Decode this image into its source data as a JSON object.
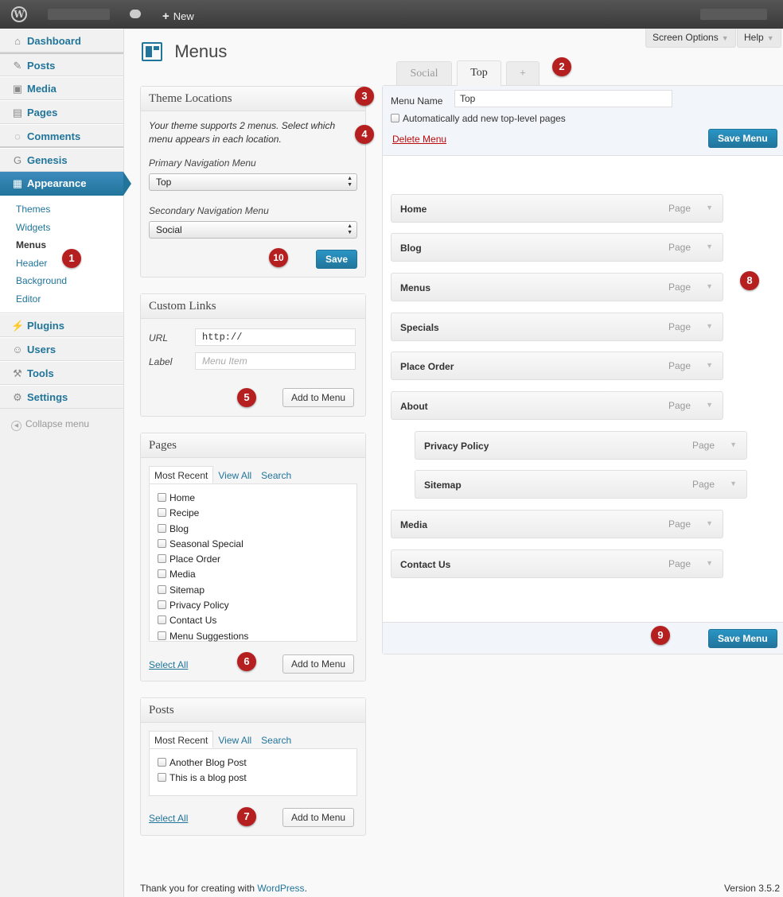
{
  "adminbar": {
    "logo": "W",
    "new_label": "New"
  },
  "sidebar": {
    "items": [
      {
        "label": "Dashboard",
        "icon": "home-icon"
      },
      {
        "label": "Posts",
        "icon": "pin-icon"
      },
      {
        "label": "Media",
        "icon": "media-icon"
      },
      {
        "label": "Pages",
        "icon": "pages-icon"
      },
      {
        "label": "Comments",
        "icon": "comments-icon"
      },
      {
        "label": "Genesis",
        "icon": "genesis-icon"
      },
      {
        "label": "Appearance",
        "icon": "appearance-icon"
      }
    ],
    "submenu": [
      "Themes",
      "Widgets",
      "Menus",
      "Header",
      "Background",
      "Editor"
    ],
    "items2": [
      {
        "label": "Plugins",
        "icon": "plugins-icon"
      },
      {
        "label": "Users",
        "icon": "users-icon"
      },
      {
        "label": "Tools",
        "icon": "tools-icon"
      },
      {
        "label": "Settings",
        "icon": "settings-icon"
      }
    ],
    "collapse": "Collapse menu"
  },
  "screen_options": "Screen Options",
  "help": "Help",
  "page_title": "Menus",
  "theme_locations": {
    "title": "Theme Locations",
    "intro": "Your theme supports 2 menus. Select which menu appears in each location.",
    "primary_label": "Primary Navigation Menu",
    "primary_value": "Top",
    "secondary_label": "Secondary Navigation Menu",
    "secondary_value": "Social",
    "save": "Save"
  },
  "custom_links": {
    "title": "Custom Links",
    "url_label": "URL",
    "url_value": "http://",
    "label_label": "Label",
    "label_placeholder": "Menu Item",
    "add": "Add to Menu"
  },
  "pages_box": {
    "title": "Pages",
    "tabs": [
      "Most Recent",
      "View All",
      "Search"
    ],
    "items": [
      "Home",
      "Recipe",
      "Blog",
      "Seasonal Special",
      "Place Order",
      "Media",
      "Sitemap",
      "Privacy Policy",
      "Contact Us",
      "Menu Suggestions"
    ],
    "select_all": "Select All",
    "add": "Add to Menu"
  },
  "posts_box": {
    "title": "Posts",
    "tabs": [
      "Most Recent",
      "View All",
      "Search"
    ],
    "items": [
      "Another Blog Post",
      "This is a blog post"
    ],
    "select_all": "Select All",
    "add": "Add to Menu"
  },
  "menu_tabs": [
    "Social",
    "Top",
    "+"
  ],
  "menu_editor": {
    "name_label": "Menu Name",
    "name_value": "Top",
    "auto_add": "Automatically add new top-level pages",
    "delete": "Delete Menu",
    "save": "Save Menu"
  },
  "menu_items": [
    {
      "title": "Home",
      "type": "Page"
    },
    {
      "title": "Blog",
      "type": "Page"
    },
    {
      "title": "Menus",
      "type": "Page"
    },
    {
      "title": "Specials",
      "type": "Page"
    },
    {
      "title": "Place Order",
      "type": "Page"
    },
    {
      "title": "About",
      "type": "Page"
    },
    {
      "title": "Privacy Policy",
      "type": "Page"
    },
    {
      "title": "Sitemap",
      "type": "Page"
    },
    {
      "title": "Media",
      "type": "Page"
    },
    {
      "title": "Contact Us",
      "type": "Page"
    }
  ],
  "badges": [
    "1",
    "2",
    "3",
    "4",
    "5",
    "6",
    "7",
    "8",
    "9",
    "10"
  ],
  "footer": {
    "thanks_prefix": "Thank you for creating with",
    "thanks_link": "WordPress",
    "thanks_suffix": ".",
    "version": "Version 3.5.2"
  }
}
